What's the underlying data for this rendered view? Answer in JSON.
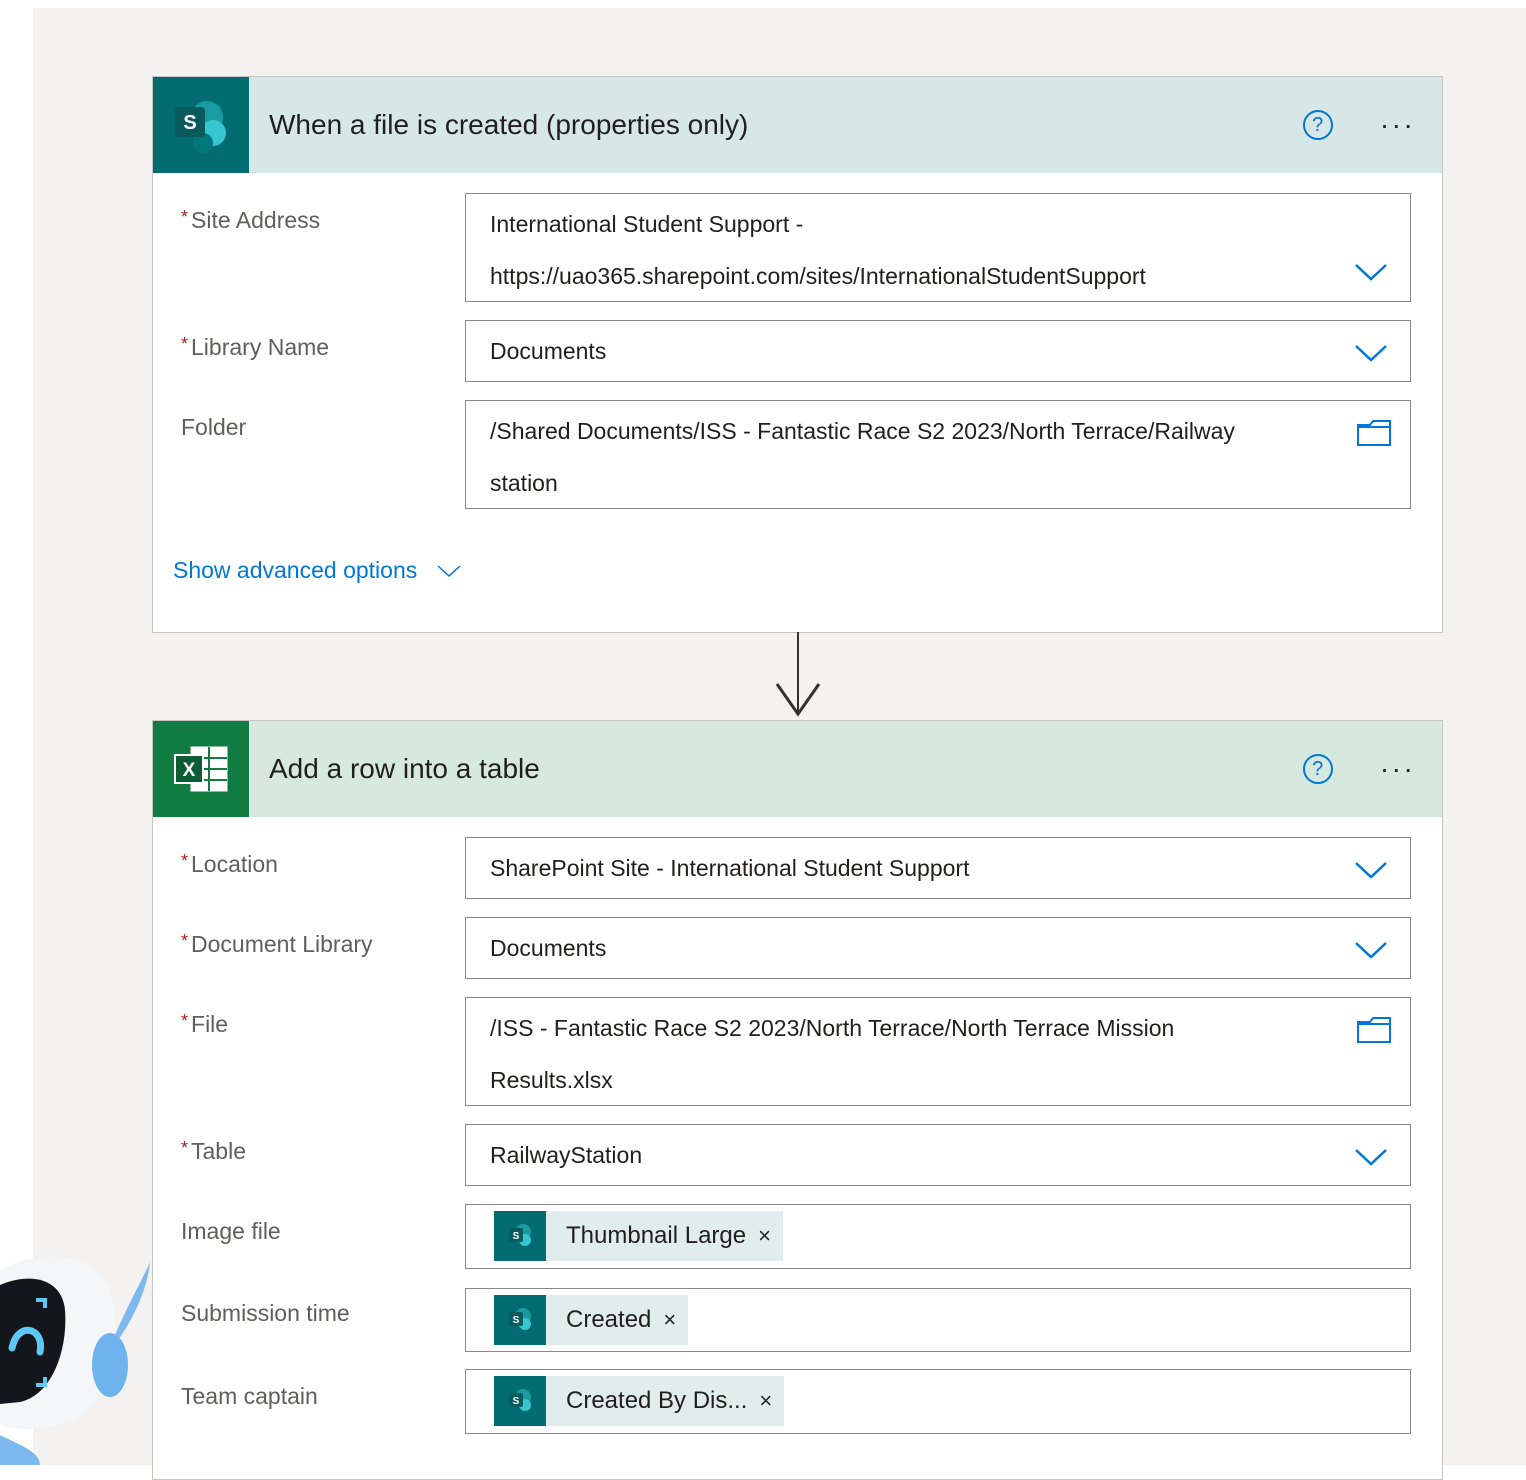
{
  "trigger": {
    "title": "When a file is created (properties only)",
    "icon": "sharepoint-icon",
    "color": "#036c70",
    "header_bg": "#d7e6e6",
    "fields": {
      "site_address": {
        "label": "Site Address",
        "line1": "International Student Support -",
        "line2": "https://uao365.sharepoint.com/sites/InternationalStudentSupport"
      },
      "library_name": {
        "label": "Library Name",
        "value": "Documents"
      },
      "folder": {
        "label": "Folder",
        "line1": "/Shared Documents/ISS - Fantastic Race S2 2023/North Terrace/Railway",
        "line2": "station"
      }
    },
    "show_advanced": "Show advanced options"
  },
  "action": {
    "title": "Add a row into a table",
    "icon": "excel-icon",
    "color": "#107c41",
    "header_bg": "#d7e8de",
    "fields": {
      "location": {
        "label": "Location",
        "value": "SharePoint Site - International Student Support"
      },
      "document_library": {
        "label": "Document Library",
        "value": "Documents"
      },
      "file": {
        "label": "File",
        "line1": "/ISS - Fantastic Race S2 2023/North Terrace/North Terrace Mission",
        "line2": "Results.xlsx"
      },
      "table": {
        "label": "Table",
        "value": "RailwayStation"
      },
      "image_file": {
        "label": "Image file",
        "token": "Thumbnail Large"
      },
      "submission_time": {
        "label": "Submission time",
        "token": "Created"
      },
      "team_captain": {
        "label": "Team captain",
        "token": "Created By Dis..."
      }
    }
  },
  "symbols": {
    "required": "*",
    "help": "?",
    "more": "...",
    "remove": "×"
  }
}
